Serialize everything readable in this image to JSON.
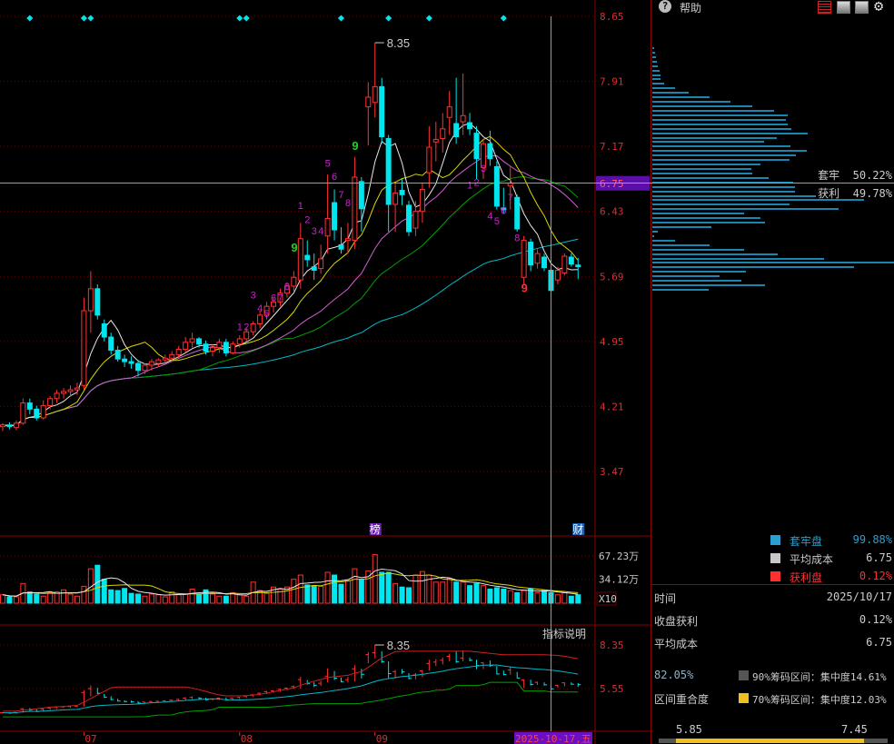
{
  "header": {
    "help_label": "帮助"
  },
  "main_axis": {
    "ticks": [
      "8.65",
      "7.91",
      "7.17",
      "6.43",
      "5.69",
      "4.95",
      "4.21",
      "3.47"
    ],
    "crosshair_price": "6.75"
  },
  "volume_axis": {
    "ticks": [
      "67.23万",
      "34.12万"
    ],
    "tick_values": [
      67.23,
      34.12
    ],
    "multiplier": "X10"
  },
  "indicator": {
    "title": "指标说明",
    "ticks": [
      "8.35",
      "5.55"
    ]
  },
  "date_axis": {
    "months": [
      {
        "label": "07",
        "index": 12
      },
      {
        "label": "08",
        "index": 35
      },
      {
        "label": "09",
        "index": 55
      }
    ],
    "cursor_date": "2025-10-17,五"
  },
  "markers": {
    "bang": "榜",
    "bang_index": 55,
    "cai": "财",
    "cai_index": 85
  },
  "chart_data": {
    "type": "candlestick",
    "ylim": [
      3.47,
      8.65
    ],
    "high_label": "8.35",
    "high_value": 8.35,
    "high_index": 55,
    "crosshair_index": 81,
    "crosshair_price": 6.75,
    "colors": {
      "up": "#ff3232",
      "down": "#00e5ee",
      "ma5": "#e8e8e8",
      "ma10": "#d8d800",
      "ma20": "#d060d0",
      "ma30": "#00a000",
      "ma60": "#00b8c8"
    },
    "ohlc": [
      [
        3.98,
        4.02,
        3.93,
        4.0
      ],
      [
        4.0,
        4.03,
        3.95,
        3.98
      ],
      [
        3.97,
        4.05,
        3.94,
        4.02
      ],
      [
        4.02,
        4.3,
        4.0,
        4.25
      ],
      [
        4.25,
        4.3,
        4.12,
        4.18
      ],
      [
        4.18,
        4.22,
        4.05,
        4.08
      ],
      [
        4.08,
        4.28,
        4.06,
        4.22
      ],
      [
        4.22,
        4.33,
        4.18,
        4.3
      ],
      [
        4.3,
        4.4,
        4.25,
        4.36
      ],
      [
        4.36,
        4.42,
        4.3,
        4.38
      ],
      [
        4.38,
        4.45,
        4.32,
        4.4
      ],
      [
        4.4,
        4.48,
        4.34,
        4.42
      ],
      [
        4.45,
        5.45,
        4.4,
        5.3
      ],
      [
        5.3,
        5.75,
        5.05,
        5.55
      ],
      [
        5.55,
        5.6,
        5.2,
        5.25
      ],
      [
        5.15,
        5.2,
        4.95,
        5.0
      ],
      [
        5.0,
        5.05,
        4.8,
        4.85
      ],
      [
        4.85,
        4.9,
        4.72,
        4.75
      ],
      [
        4.75,
        4.8,
        4.66,
        4.72
      ],
      [
        4.72,
        4.78,
        4.64,
        4.7
      ],
      [
        4.7,
        4.74,
        4.55,
        4.62
      ],
      [
        4.62,
        4.7,
        4.58,
        4.68
      ],
      [
        4.68,
        4.75,
        4.62,
        4.72
      ],
      [
        4.7,
        4.76,
        4.66,
        4.74
      ],
      [
        4.74,
        4.8,
        4.7,
        4.76
      ],
      [
        4.76,
        4.84,
        4.72,
        4.8
      ],
      [
        4.8,
        4.9,
        4.76,
        4.86
      ],
      [
        4.86,
        5.0,
        4.82,
        4.94
      ],
      [
        4.94,
        5.05,
        4.88,
        4.98
      ],
      [
        4.98,
        5.0,
        4.88,
        4.92
      ],
      [
        4.92,
        4.96,
        4.8,
        4.84
      ],
      [
        4.84,
        4.92,
        4.78,
        4.88
      ],
      [
        4.88,
        4.98,
        4.82,
        4.94
      ],
      [
        4.94,
        4.98,
        4.78,
        4.82
      ],
      [
        4.82,
        4.95,
        4.8,
        4.92
      ],
      [
        4.92,
        5.02,
        4.88,
        4.98
      ],
      [
        4.98,
        5.1,
        4.95,
        5.06
      ],
      [
        5.06,
        5.18,
        5.02,
        5.15
      ],
      [
        5.15,
        5.3,
        5.1,
        5.25
      ],
      [
        5.25,
        5.4,
        5.2,
        5.35
      ],
      [
        5.35,
        5.45,
        5.28,
        5.4
      ],
      [
        5.4,
        5.55,
        5.35,
        5.5
      ],
      [
        5.5,
        5.62,
        5.45,
        5.58
      ],
      [
        5.58,
        5.75,
        5.52,
        5.68
      ],
      [
        5.65,
        6.3,
        5.55,
        6.12
      ],
      [
        5.93,
        6.1,
        5.8,
        5.88
      ],
      [
        5.8,
        5.95,
        5.65,
        5.76
      ],
      [
        5.78,
        6.05,
        5.72,
        5.89
      ],
      [
        6.15,
        6.85,
        5.95,
        6.35
      ],
      [
        6.53,
        6.68,
        6.1,
        6.22
      ],
      [
        6.05,
        6.25,
        5.95,
        6.0
      ],
      [
        6.1,
        6.3,
        5.95,
        6.12
      ],
      [
        6.1,
        7.05,
        6.0,
        6.82
      ],
      [
        6.77,
        6.82,
        6.2,
        6.46
      ],
      [
        7.62,
        7.9,
        7.18,
        7.73
      ],
      [
        7.67,
        8.35,
        7.5,
        7.85
      ],
      [
        7.85,
        7.95,
        7.2,
        7.28
      ],
      [
        7.26,
        7.3,
        6.2,
        6.51
      ],
      [
        6.51,
        6.75,
        6.2,
        6.64
      ],
      [
        6.67,
        6.8,
        6.5,
        6.62
      ],
      [
        6.5,
        6.55,
        6.15,
        6.2
      ],
      [
        6.24,
        6.55,
        6.15,
        6.43
      ],
      [
        6.43,
        6.75,
        6.3,
        6.68
      ],
      [
        6.87,
        7.4,
        6.7,
        7.16
      ],
      [
        7.22,
        7.45,
        7.0,
        7.25
      ],
      [
        7.26,
        7.55,
        7.1,
        7.37
      ],
      [
        7.5,
        7.8,
        7.3,
        7.62
      ],
      [
        7.43,
        7.95,
        7.2,
        7.28
      ],
      [
        7.45,
        8.0,
        7.3,
        7.52
      ],
      [
        7.44,
        7.55,
        7.3,
        7.37
      ],
      [
        7.32,
        7.4,
        6.8,
        7.03
      ],
      [
        6.93,
        7.25,
        6.8,
        7.2
      ],
      [
        7.2,
        7.35,
        6.95,
        7.03
      ],
      [
        6.94,
        7.0,
        6.45,
        6.49
      ],
      [
        6.47,
        6.7,
        6.4,
        6.45
      ],
      [
        6.72,
        6.95,
        6.45,
        6.75
      ],
      [
        6.59,
        6.62,
        6.2,
        6.23
      ],
      [
        5.68,
        6.15,
        5.6,
        6.1
      ],
      [
        6.08,
        6.12,
        5.75,
        5.82
      ],
      [
        5.84,
        6.0,
        5.78,
        5.95
      ],
      [
        5.91,
        5.95,
        5.75,
        5.79
      ],
      [
        5.76,
        5.78,
        5.53,
        5.53
      ],
      [
        5.65,
        5.8,
        5.6,
        5.76
      ],
      [
        5.73,
        5.95,
        5.7,
        5.92
      ],
      [
        5.91,
        5.95,
        5.8,
        5.83
      ],
      [
        5.82,
        5.9,
        5.66,
        5.8
      ]
    ],
    "volume": [
      12,
      9,
      9,
      28,
      16,
      13,
      10,
      15,
      16,
      19,
      13,
      10,
      24,
      49,
      54,
      34,
      19,
      18,
      21,
      14,
      13,
      10,
      13,
      12,
      9,
      16,
      12,
      13,
      20,
      13,
      19,
      13,
      10,
      10,
      15,
      12,
      10,
      30,
      18,
      14,
      23,
      20,
      23,
      34,
      40,
      26,
      25,
      24,
      44,
      40,
      27,
      32,
      49,
      34,
      46,
      69,
      44,
      44,
      28,
      23,
      22,
      40,
      45,
      40,
      30,
      30,
      35,
      30,
      30,
      25,
      28,
      25,
      20,
      22,
      20,
      18,
      15,
      18,
      20,
      15,
      18,
      15,
      12,
      15,
      10,
      12
    ],
    "signal_diamonds": [
      4,
      12,
      13,
      35,
      36,
      50,
      57,
      63,
      74
    ],
    "td_labels": [
      {
        "index": 35,
        "price": 5.08,
        "text": "1",
        "color": "#d020d0"
      },
      {
        "index": 36,
        "price": 5.08,
        "text": "2",
        "color": "#d020d0"
      },
      {
        "index": 37,
        "price": 5.44,
        "text": "3",
        "color": "#d020d0"
      },
      {
        "index": 38,
        "price": 5.29,
        "text": "4",
        "color": "#d020d0"
      },
      {
        "index": 39,
        "price": 5.23,
        "text": "5",
        "color": "#d020d0"
      },
      {
        "index": 40,
        "price": 5.41,
        "text": "6",
        "color": "#d020d0"
      },
      {
        "index": 41,
        "price": 5.41,
        "text": "7",
        "color": "#d020d0"
      },
      {
        "index": 42,
        "price": 5.54,
        "text": "8",
        "color": "#d020d0"
      },
      {
        "index": 43,
        "price": 5.97,
        "text": "9",
        "color": "#20d020"
      },
      {
        "index": 44,
        "price": 6.46,
        "text": "1",
        "color": "#d020d0"
      },
      {
        "index": 45,
        "price": 6.3,
        "text": "2",
        "color": "#d020d0"
      },
      {
        "index": 46,
        "price": 6.17,
        "text": "3",
        "color": "#d020d0"
      },
      {
        "index": 47,
        "price": 6.17,
        "text": "4",
        "color": "#d020d0"
      },
      {
        "index": 48,
        "price": 6.94,
        "text": "5",
        "color": "#d020d0"
      },
      {
        "index": 49,
        "price": 6.79,
        "text": "6",
        "color": "#d020d0"
      },
      {
        "index": 50,
        "price": 6.58,
        "text": "7",
        "color": "#d020d0"
      },
      {
        "index": 51,
        "price": 6.49,
        "text": "8",
        "color": "#d020d0"
      },
      {
        "index": 52,
        "price": 7.13,
        "text": "9",
        "color": "#20d020"
      },
      {
        "index": 69,
        "price": 6.69,
        "text": "1",
        "color": "#d020d0"
      },
      {
        "index": 70,
        "price": 6.72,
        "text": "2",
        "color": "#d020d0"
      },
      {
        "index": 71,
        "price": 6.88,
        "text": "3",
        "color": "#d020d0"
      },
      {
        "index": 72,
        "price": 6.34,
        "text": "4",
        "color": "#d020d0"
      },
      {
        "index": 73,
        "price": 6.28,
        "text": "5",
        "color": "#d020d0"
      },
      {
        "index": 74,
        "price": 6.4,
        "text": "6",
        "color": "#d020d0"
      },
      {
        "index": 75,
        "price": 6.55,
        "text": "7",
        "color": "#d020d0"
      },
      {
        "index": 76,
        "price": 6.09,
        "text": "8",
        "color": "#d020d0"
      },
      {
        "index": 77,
        "price": 5.51,
        "text": "9",
        "color": "#ff3030"
      }
    ]
  },
  "chip_panel": {
    "price_range": [
      8.3,
      5.55
    ],
    "bars": [
      2,
      3,
      4,
      5,
      6,
      8,
      9,
      9,
      13,
      25,
      40,
      63,
      87,
      111,
      135,
      150,
      148,
      150,
      154,
      172,
      138,
      124,
      153,
      171,
      159,
      152,
      120,
      110,
      111,
      129,
      156,
      158,
      158,
      181,
      235,
      152,
      207,
      102,
      120,
      125,
      65,
      6,
      2,
      25,
      63,
      102,
      139,
      190,
      268,
      224,
      104,
      75,
      99,
      125,
      62
    ],
    "bar_color": "#1a86b0",
    "trapped_label": "套牢",
    "trapped_value": "50.22%",
    "profit_label": "获利",
    "profit_value": "49.78%",
    "legend": [
      {
        "label": "套牢盘",
        "value": "99.88%",
        "color": "#2a9fd0"
      },
      {
        "label": "平均成本",
        "value": "6.75",
        "color": "#c8c8c8"
      },
      {
        "label": "获利盘",
        "value": "0.12%",
        "color": "#ff3030"
      }
    ],
    "stats": [
      {
        "label": "时间",
        "value": "2025/10/17"
      },
      {
        "label": "收盘获利",
        "value": "0.12%"
      },
      {
        "label": "平均成本",
        "value": "6.75"
      }
    ],
    "overlap_value": "82.05%",
    "overlap_label": "区间重合度",
    "range90": {
      "text": "90%筹码区间：集中度14.61%",
      "color": "#555555"
    },
    "range70": {
      "text": "70%筹码区间：集中度12.03%",
      "color": "#f0c020"
    },
    "range_low": "5.85",
    "range_high": "7.45"
  }
}
